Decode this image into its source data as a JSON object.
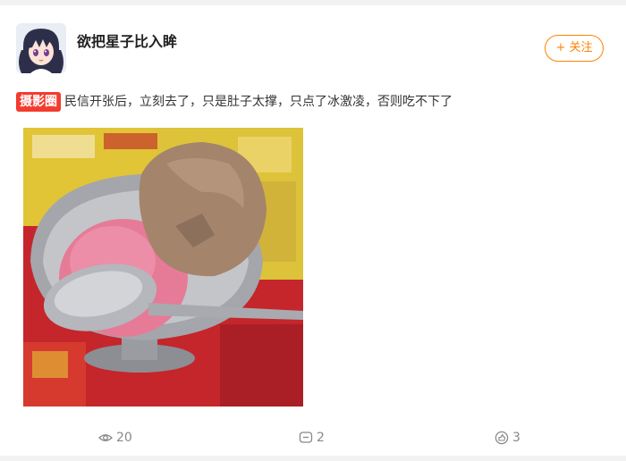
{
  "user": {
    "name": "欲把星子比入眸"
  },
  "follow": {
    "label": "+ 关注"
  },
  "post": {
    "tag": "摄影圈",
    "text": "民信开张后，立刻去了，只是肚子太撑，只点了冰激凌，否则吃不下了"
  },
  "stats": {
    "views": "20",
    "comments": "2",
    "likes": "3"
  },
  "colors": {
    "accent": "#ff8200",
    "tag": "#f33b2f"
  },
  "icons": {
    "views": "eye-icon",
    "comments": "comment-icon",
    "likes": "thumbs-up-icon"
  }
}
